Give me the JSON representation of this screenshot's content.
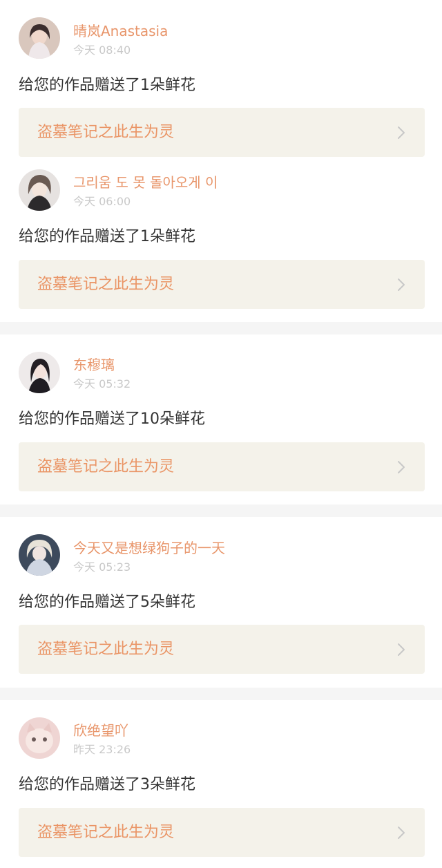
{
  "notifications": [
    {
      "username": "晴岚Anastasia",
      "time": "今天 08:40",
      "message": "给您的作品赠送了1朵鲜花",
      "work_title": "盗墓笔记之此生为灵",
      "avatar_icon": "user-avatar-icon"
    },
    {
      "username": "그리움 도 못 돌아오게 이",
      "time": "今天 06:00",
      "message": "给您的作品赠送了1朵鲜花",
      "work_title": "盗墓笔记之此生为灵",
      "avatar_icon": "user-avatar-icon"
    },
    {
      "username": "东穆璃",
      "time": "今天 05:32",
      "message": "给您的作品赠送了10朵鲜花",
      "work_title": "盗墓笔记之此生为灵",
      "avatar_icon": "user-avatar-icon"
    },
    {
      "username": "今天又是想绿狗子的一天",
      "time": "今天 05:23",
      "message": "给您的作品赠送了5朵鲜花",
      "work_title": "盗墓笔记之此生为灵",
      "avatar_icon": "user-avatar-icon"
    },
    {
      "username": "欣绝望吖",
      "time": "昨天 23:26",
      "message": "给您的作品赠送了3朵鲜花",
      "work_title": "盗墓笔记之此生为灵",
      "avatar_icon": "user-avatar-icon"
    }
  ],
  "colors": {
    "username": "#e8956a",
    "time": "#c9c9c9",
    "message": "#333333",
    "card_background": "#f4f2ea",
    "work_title": "#ea9566",
    "separator": "#f5f5f5"
  }
}
